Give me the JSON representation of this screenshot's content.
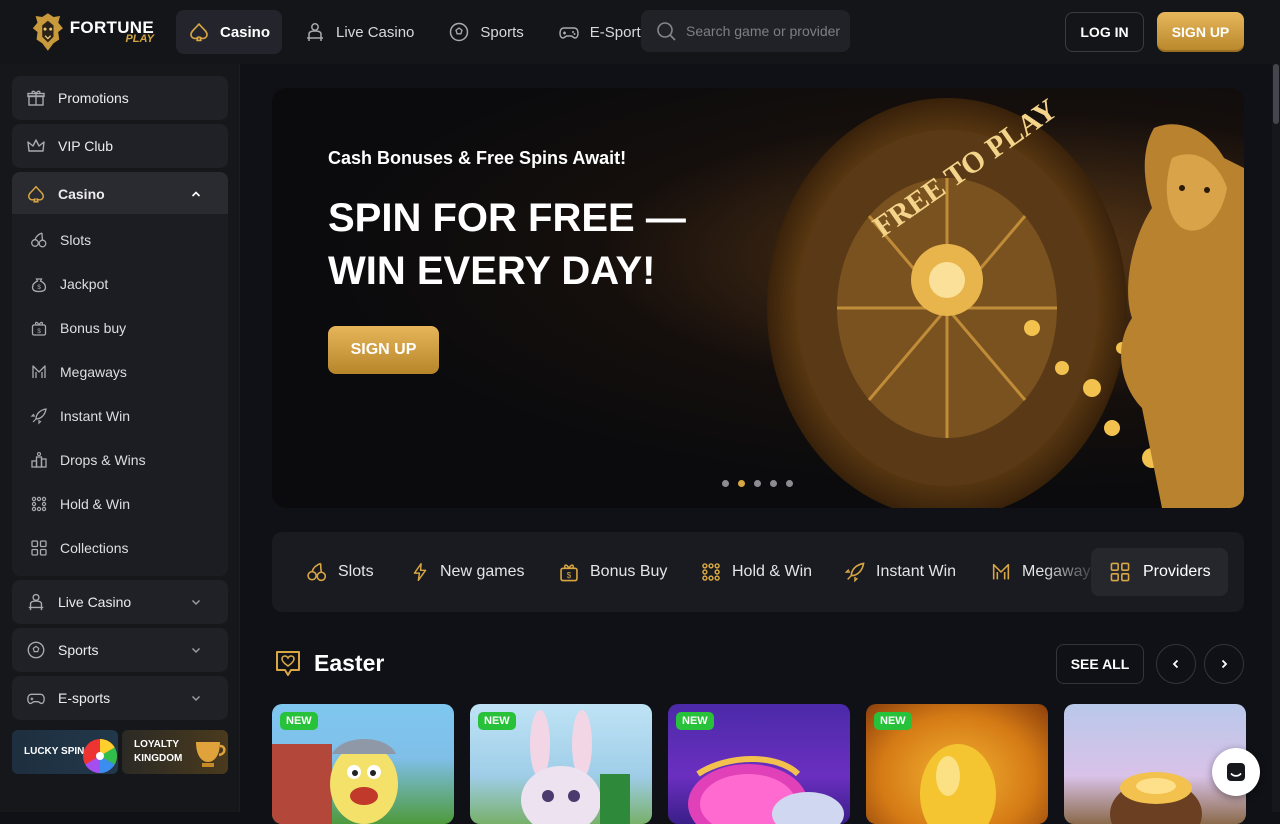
{
  "brand": {
    "name": "FORTUNE",
    "sub": "PLAY"
  },
  "nav": [
    {
      "label": "Casino",
      "icon": "spade-icon",
      "active": true
    },
    {
      "label": "Live Casino",
      "icon": "dealer-icon"
    },
    {
      "label": "Sports",
      "icon": "soccer-ball-icon"
    },
    {
      "label": "E-Sports",
      "icon": "gamepad-icon"
    }
  ],
  "search": {
    "placeholder": "Search game or provider"
  },
  "auth": {
    "login": "LOG IN",
    "signup": "SIGN UP"
  },
  "sidebar": {
    "promotions": "Promotions",
    "vip": "VIP Club",
    "casino": "Casino",
    "casino_items": [
      "Slots",
      "Jackpot",
      "Bonus buy",
      "Megaways",
      "Instant Win",
      "Drops & Wins",
      "Hold & Win",
      "Collections"
    ],
    "live_casino": "Live Casino",
    "sports": "Sports",
    "esports": "E-sports",
    "lucky_spin": "LUCKY SPIN",
    "loyalty_1": "LOYALTY",
    "loyalty_2": "KINGDOM"
  },
  "hero": {
    "subtitle": "Cash Bonuses & Free Spins Await!",
    "title_line1": "SPIN FOR FREE —",
    "title_line2": "WIN EVERY DAY!",
    "button": "SIGN UP",
    "wheel_text": "FREE TO PLAY",
    "slide_count": 5,
    "active_slide": 2
  },
  "categories": [
    "Slots",
    "New games",
    "Bonus Buy",
    "Hold & Win",
    "Instant Win",
    "Megaways"
  ],
  "providers_label": "Providers",
  "section": {
    "title": "Easter",
    "see_all": "SEE ALL"
  },
  "games": [
    {
      "badge": "NEW"
    },
    {
      "badge": "NEW"
    },
    {
      "badge": "NEW"
    },
    {
      "badge": "NEW"
    },
    {
      "badge": ""
    }
  ],
  "colors": {
    "accent": "#d8a744",
    "new_badge": "#27c13a",
    "bg": "#101116"
  }
}
